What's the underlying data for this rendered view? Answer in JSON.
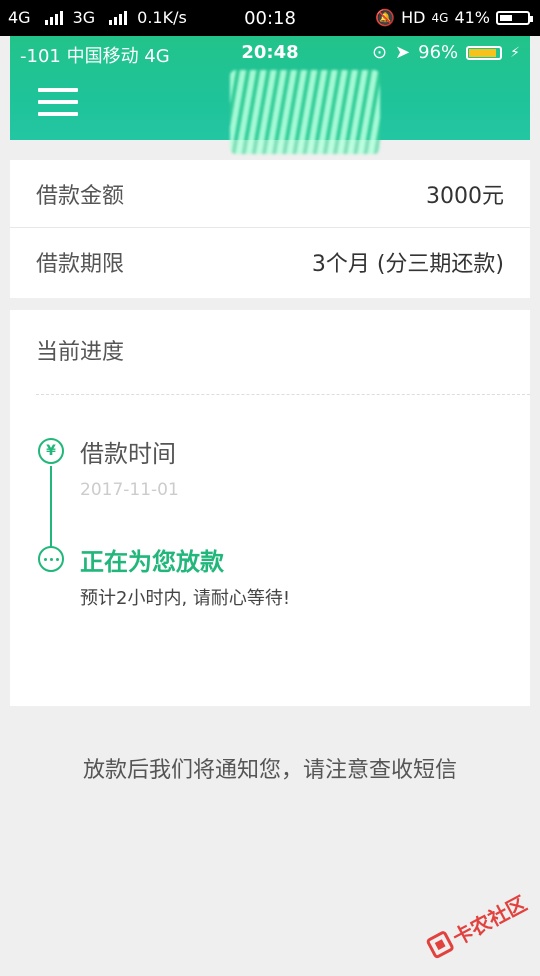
{
  "outer_status": {
    "net1": "4G",
    "net2": "3G",
    "speed": "0.1K/s",
    "time": "00:18",
    "hd": "HD",
    "net3": "4G",
    "battery": "41%"
  },
  "inner_status": {
    "carrier": "-101 中国移动  4G",
    "time": "20:48",
    "battery": "96%"
  },
  "loan": {
    "amount_label": "借款金额",
    "amount_value": "3000元",
    "term_label": "借款期限",
    "term_value": "3个月 (分三期还款)"
  },
  "progress": {
    "title": "当前进度",
    "step1": {
      "icon": "yen-icon",
      "title": "借款时间",
      "date": "2017-11-01"
    },
    "step2": {
      "icon": "more-dots-icon",
      "title": "正在为您放款",
      "desc": "预计2小时内, 请耐心等待!"
    }
  },
  "notice": "放款后我们将通知您，请注意查收短信",
  "watermark": "卡农社区",
  "colors": {
    "accent": "#22b77a",
    "header": "#22c38a"
  }
}
